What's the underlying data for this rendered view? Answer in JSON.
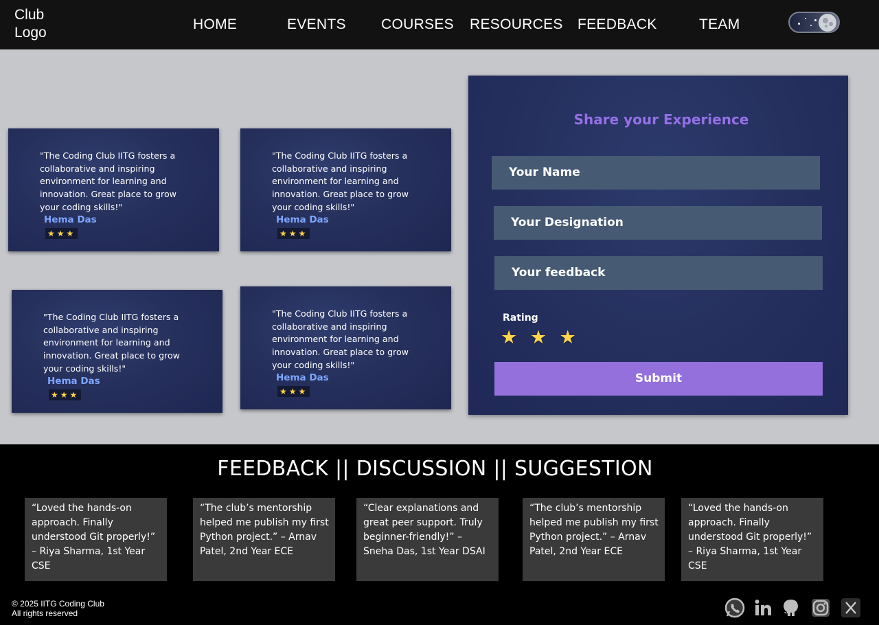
{
  "nav": {
    "logo": "Club\nLogo",
    "links": [
      "HOME",
      "EVENTS",
      "COURSES",
      "RESOURCES",
      "FEEDBACK",
      "TEAM"
    ]
  },
  "testimonials": [
    {
      "quote": "\"The Coding Club IITG fosters a collaborative and inspiring environment for learning and innovation. Great place to grow your coding skills!\"",
      "author": "Hema Das",
      "stars": "★★★",
      "rating": 3
    },
    {
      "quote": "\"The Coding Club IITG fosters a collaborative and inspiring environment for learning and innovation. Great place to grow your coding skills!\"",
      "author": "Hema Das",
      "stars": "★★★",
      "rating": 3
    },
    {
      "quote": "\"The Coding Club IITG fosters a collaborative and inspiring environment for learning and innovation. Great place to grow your coding skills!\"",
      "author": "Hema Das",
      "stars": "★★★",
      "rating": 3
    },
    {
      "quote": "\"The Coding Club IITG fosters a collaborative and inspiring environment for learning and innovation. Great place to grow your coding skills!\"",
      "author": "Hema Das",
      "stars": "★★★",
      "rating": 3
    }
  ],
  "form": {
    "title": "Share your Experience",
    "name_placeholder": "Your Name",
    "designation_placeholder": "Your Designation",
    "feedback_placeholder": "Your feedback",
    "rating_label": "Rating",
    "rating_stars": [
      "★",
      "★",
      "★"
    ],
    "rating": 3,
    "submit_label": "Submit"
  },
  "footer": {
    "title": "FEEDBACK || DISCUSSION || SUGGESTION",
    "cards": [
      "“Loved the hands-on approach. Finally understood Git properly!” – Riya Sharma, 1st Year CSE",
      "“The club’s mentorship helped me publish my first Python project.” – Arnav Patel, 2nd Year ECE",
      "“Clear explanations and great peer support. Truly beginner-friendly!” – Sneha Das, 1st Year DSAI",
      "“The club’s mentorship helped me publish my first Python project.” – Arnav Patel, 2nd Year ECE",
      "“Loved the hands-on approach. Finally understood Git properly!” – Riya Sharma, 1st Year CSE"
    ],
    "copyright_line1": "© 2025 IITG Coding Club",
    "copyright_line2": "All rights reserved",
    "socials": [
      "whatsapp-icon",
      "linkedin-icon",
      "github-icon",
      "instagram-icon",
      "x-icon"
    ]
  },
  "colors": {
    "accent": "#9370db",
    "author": "#7fa6ff",
    "star": "#ffd54a",
    "input": "#465a74"
  }
}
